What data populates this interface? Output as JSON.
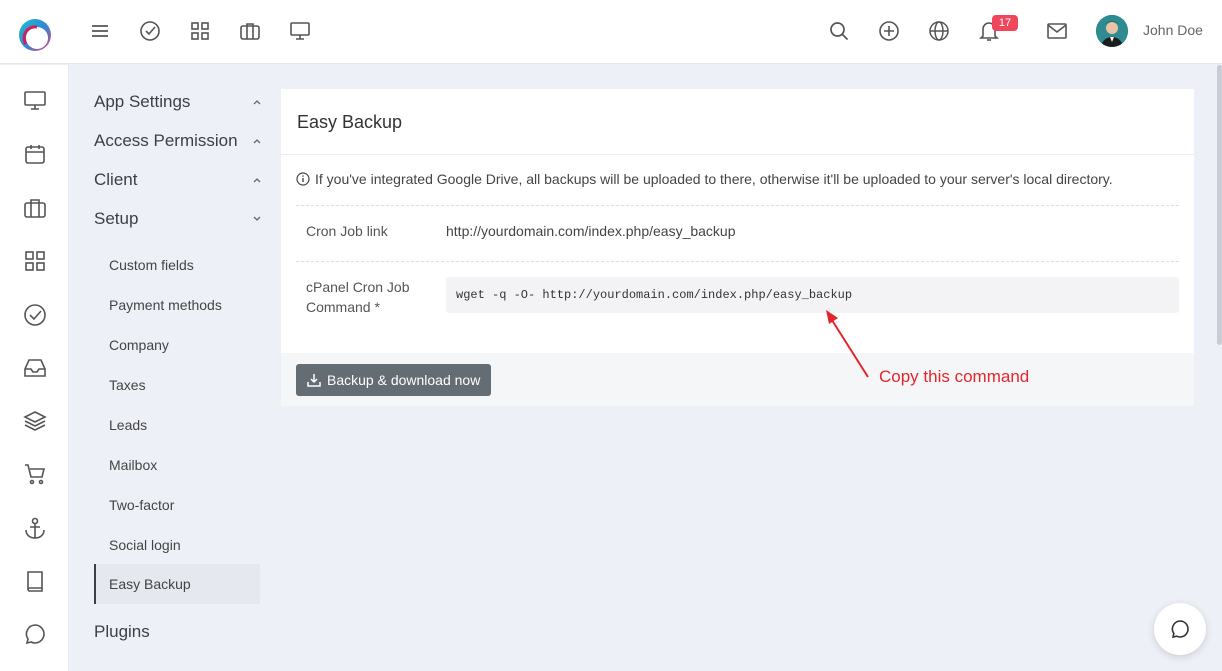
{
  "topbar": {
    "notification_count": "17",
    "user_name": "John Doe",
    "icons": [
      "menu-icon",
      "check-circle-icon",
      "grid-icon",
      "briefcase-icon",
      "monitor-icon",
      "search-icon",
      "plus-circle-icon",
      "globe-icon",
      "bell-icon",
      "mail-icon"
    ]
  },
  "rail": {
    "icons": [
      "monitor-icon",
      "calendar-icon",
      "briefcase-icon",
      "grid-icon",
      "check-circle-icon",
      "inbox-icon",
      "layers-icon",
      "cart-icon",
      "anchor-icon",
      "book-icon",
      "chat-icon"
    ]
  },
  "menu": {
    "app_settings": "App Settings",
    "access_permission": "Access Permission",
    "client": "Client",
    "setup": "Setup",
    "plugins": "Plugins",
    "setup_children": [
      "Custom fields",
      "Payment methods",
      "Company",
      "Taxes",
      "Leads",
      "Mailbox",
      "Two-factor",
      "Social login",
      "Easy Backup"
    ]
  },
  "card": {
    "title": "Easy Backup",
    "info": "If you've integrated Google Drive, all backups will be uploaded to there, otherwise it'll be uploaded to your server's local directory.",
    "cron_label": "Cron Job link",
    "cron_value": "http://yourdomain.com/index.php/easy_backup",
    "cpanel_label_1": "cPanel Cron Job",
    "cpanel_label_2": "Command *",
    "cpanel_command": "wget -q -O- http://yourdomain.com/index.php/easy_backup",
    "button_label": "Backup & download now"
  },
  "annotation": "Copy this command",
  "colors": {
    "accent": "#e3262b",
    "badge": "#f0465c",
    "button": "#646c74"
  }
}
